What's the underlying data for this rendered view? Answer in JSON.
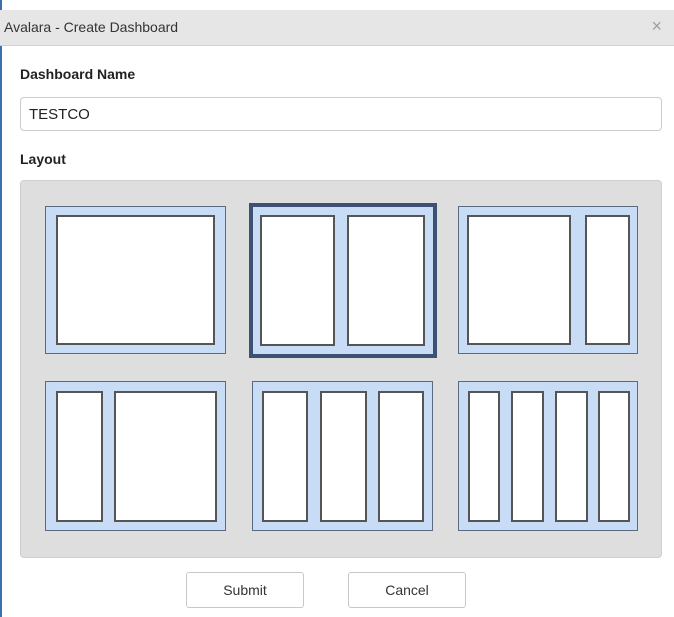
{
  "dialog": {
    "title": "Avalara - Create Dashboard",
    "close_symbol": "×"
  },
  "form": {
    "name_label": "Dashboard Name",
    "name_value": "TESTCO",
    "layout_label": "Layout"
  },
  "layouts": [
    {
      "id": "one-column",
      "columns": 1,
      "selected": false
    },
    {
      "id": "two-equal-columns",
      "columns": 2,
      "selected": true
    },
    {
      "id": "wide-narrow",
      "columns": 2,
      "selected": false
    },
    {
      "id": "narrow-wide",
      "columns": 2,
      "selected": false
    },
    {
      "id": "three-columns",
      "columns": 3,
      "selected": false
    },
    {
      "id": "four-columns",
      "columns": 4,
      "selected": false
    }
  ],
  "buttons": {
    "submit_label": "Submit",
    "cancel_label": "Cancel"
  },
  "colors": {
    "layout_fill": "#c8dcf5",
    "selected_border": "#3e5174",
    "panel_background": "#dedede"
  }
}
